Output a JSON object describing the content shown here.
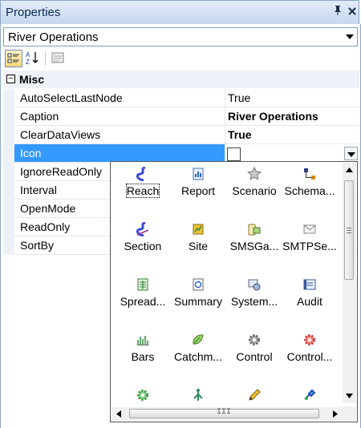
{
  "window": {
    "title": "Properties",
    "pin_glyph": "H",
    "close_glyph": "×"
  },
  "object_selector": {
    "value": "River Operations"
  },
  "toolbar": {
    "categorized_icon": "categorized-icon",
    "alphabetical_icon": "alphabetical-icon",
    "property_pages_icon": "property-pages-icon"
  },
  "category": {
    "name": "Misc",
    "toggle": "−"
  },
  "properties": [
    {
      "name": "AutoSelectLastNode",
      "value": "True",
      "bold": false
    },
    {
      "name": "Caption",
      "value": "River Operations",
      "bold": true
    },
    {
      "name": "ClearDataViews",
      "value": "True",
      "bold": true
    },
    {
      "name": "Icon",
      "value": "",
      "bold": false
    },
    {
      "name": "IgnoreReadOnly",
      "value": "",
      "bold": false
    },
    {
      "name": "Interval",
      "value": "",
      "bold": false
    },
    {
      "name": "OpenMode",
      "value": "",
      "bold": false
    },
    {
      "name": "ReadOnly",
      "value": "",
      "bold": false
    },
    {
      "name": "SortBy",
      "value": "",
      "bold": false
    }
  ],
  "icon_picker": {
    "items": [
      {
        "label": "Reach",
        "icon": "reach-icon",
        "selected": true
      },
      {
        "label": "Report",
        "icon": "report-icon"
      },
      {
        "label": "Scenario",
        "icon": "scenario-icon"
      },
      {
        "label": "Schema...",
        "icon": "schema-icon"
      },
      {
        "label": "Section",
        "icon": "section-icon"
      },
      {
        "label": "Site",
        "icon": "site-icon"
      },
      {
        "label": "SMSGa...",
        "icon": "sms-gateway-icon"
      },
      {
        "label": "SMTPSe...",
        "icon": "smtp-server-icon"
      },
      {
        "label": "Spread...",
        "icon": "spreadsheet-icon"
      },
      {
        "label": "Summary",
        "icon": "summary-icon"
      },
      {
        "label": "System...",
        "icon": "system-icon"
      },
      {
        "label": "Audit",
        "icon": "audit-icon"
      },
      {
        "label": "Bars",
        "icon": "bars-icon"
      },
      {
        "label": "Catchm...",
        "icon": "catchment-icon"
      },
      {
        "label": "Control",
        "icon": "control-icon"
      },
      {
        "label": "Control...",
        "icon": "control-red-icon"
      },
      {
        "label": "",
        "icon": "gear-green-icon"
      },
      {
        "label": "",
        "icon": "tree-icon"
      },
      {
        "label": "",
        "icon": "pencil-icon"
      },
      {
        "label": "",
        "icon": "blue-tool-icon"
      }
    ],
    "hscroll_grip": "III",
    "vscroll_grip": "≡"
  },
  "colors": {
    "selection": "#3399ff",
    "title_gradient_top": "#e2ecf8",
    "title_gradient_bottom": "#c6d8ef"
  }
}
